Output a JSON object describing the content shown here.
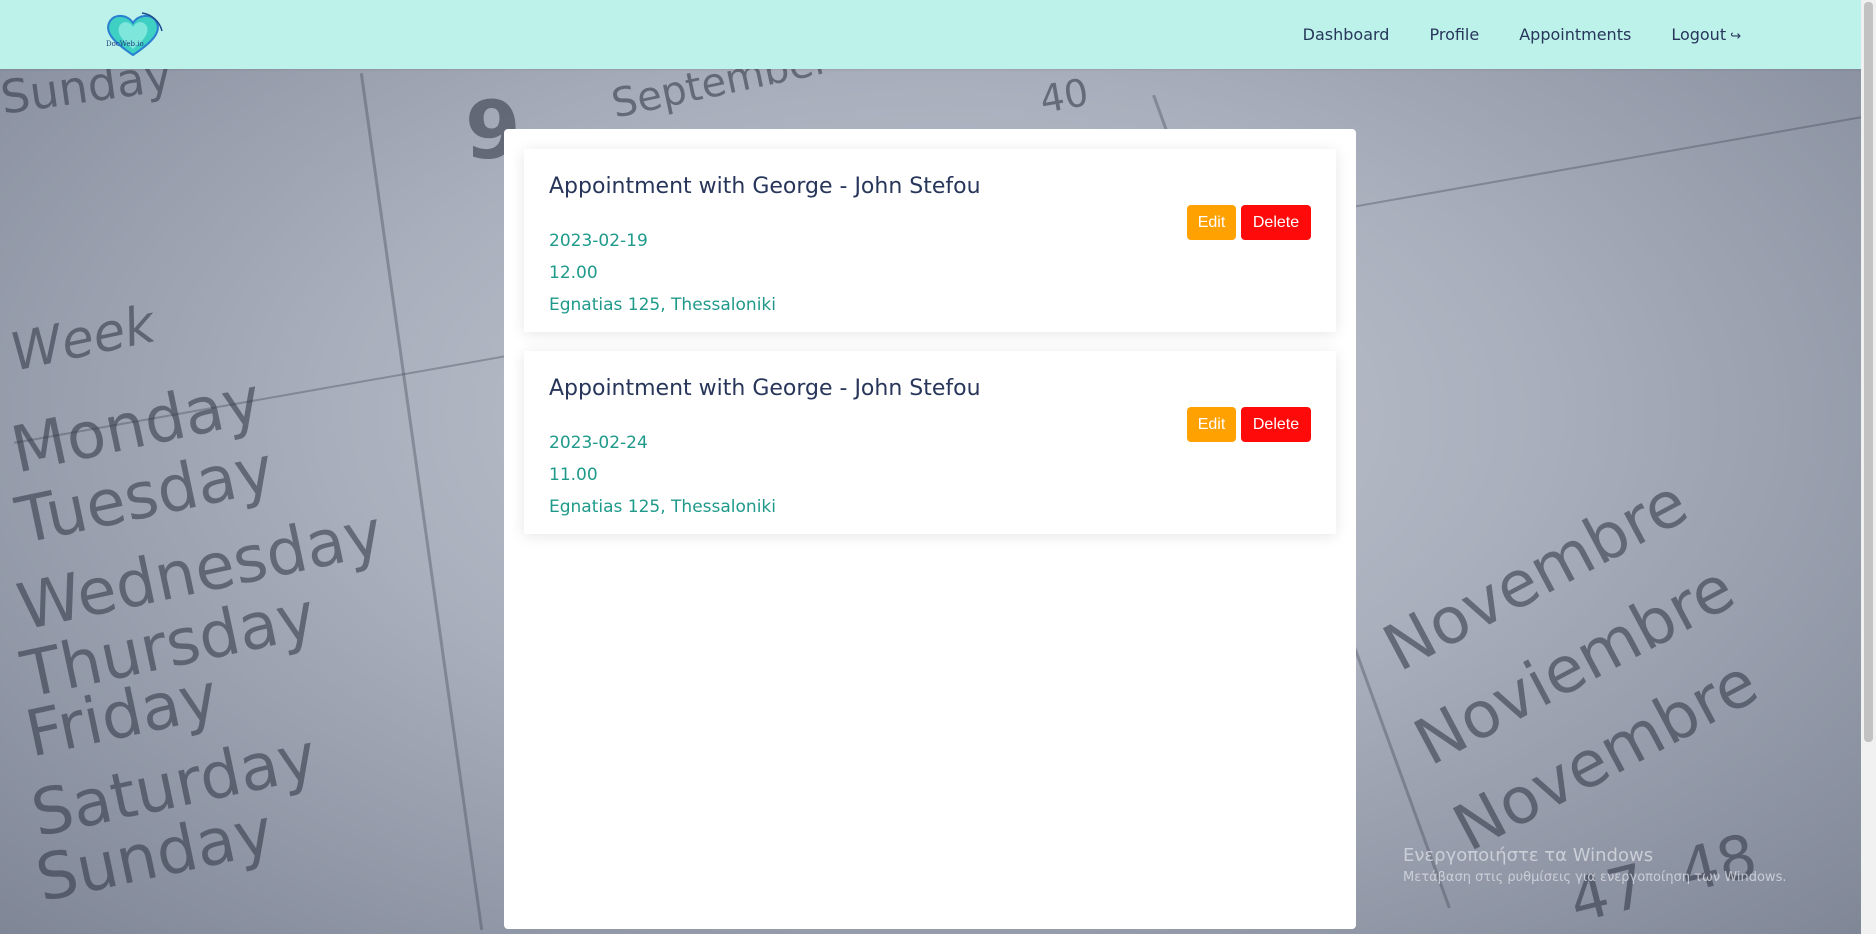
{
  "navbar": {
    "logo_text": "DocWeb.io",
    "items": [
      {
        "label": "Dashboard"
      },
      {
        "label": "Profile"
      },
      {
        "label": "Appointments"
      },
      {
        "label": "Logout",
        "icon": "logout-arrow-icon"
      }
    ]
  },
  "appointments": [
    {
      "title": "Appointment with George - John Stefou",
      "date": "2023-02-19",
      "time": "12.00",
      "address": "Egnatias 125, Thessaloniki",
      "edit_label": "Edit",
      "delete_label": "Delete"
    },
    {
      "title": "Appointment with George - John Stefou",
      "date": "2023-02-24",
      "time": "11.00",
      "address": "Egnatias 125, Thessaloniki",
      "edit_label": "Edit",
      "delete_label": "Delete"
    }
  ],
  "background": {
    "words": [
      "Sunday",
      "Week",
      "Monday",
      "Tuesday",
      "Wednesday",
      "Thursday",
      "Friday",
      "Saturday",
      "Sunday",
      "September",
      "9",
      "40",
      "Novembre",
      "Noviembre",
      "Novembre",
      "47",
      "48"
    ]
  },
  "watermark": {
    "title": "Ενεργοποιήστε τα Windows",
    "subtitle": "Μετάβαση στις ρυθμίσεις για ενεργοποίηση των Windows."
  },
  "colors": {
    "navbar_bg": "#bdf2eb",
    "title_text": "#27365a",
    "meta_text": "#1f9a8a",
    "edit_button": "#ffa100",
    "delete_button": "#ff0a0a"
  }
}
